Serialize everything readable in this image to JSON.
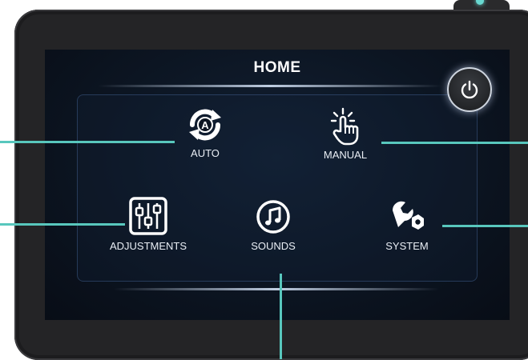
{
  "screen": {
    "title": "HOME"
  },
  "tiles": {
    "auto": {
      "label": "AUTO",
      "icon": "auto-refresh-icon"
    },
    "manual": {
      "label": "MANUAL",
      "icon": "hand-tap-icon"
    },
    "adjustments": {
      "label": "ADJUSTMENTS",
      "icon": "sliders-icon"
    },
    "sounds": {
      "label": "SOUNDS",
      "icon": "music-note-icon"
    },
    "system": {
      "label": "SYSTEM",
      "icon": "wrench-icon"
    }
  },
  "power": {
    "icon": "power-icon"
  },
  "colors": {
    "accent": "#58c7bd",
    "screen_bg": "#0c1522",
    "bezel": "#242426"
  }
}
